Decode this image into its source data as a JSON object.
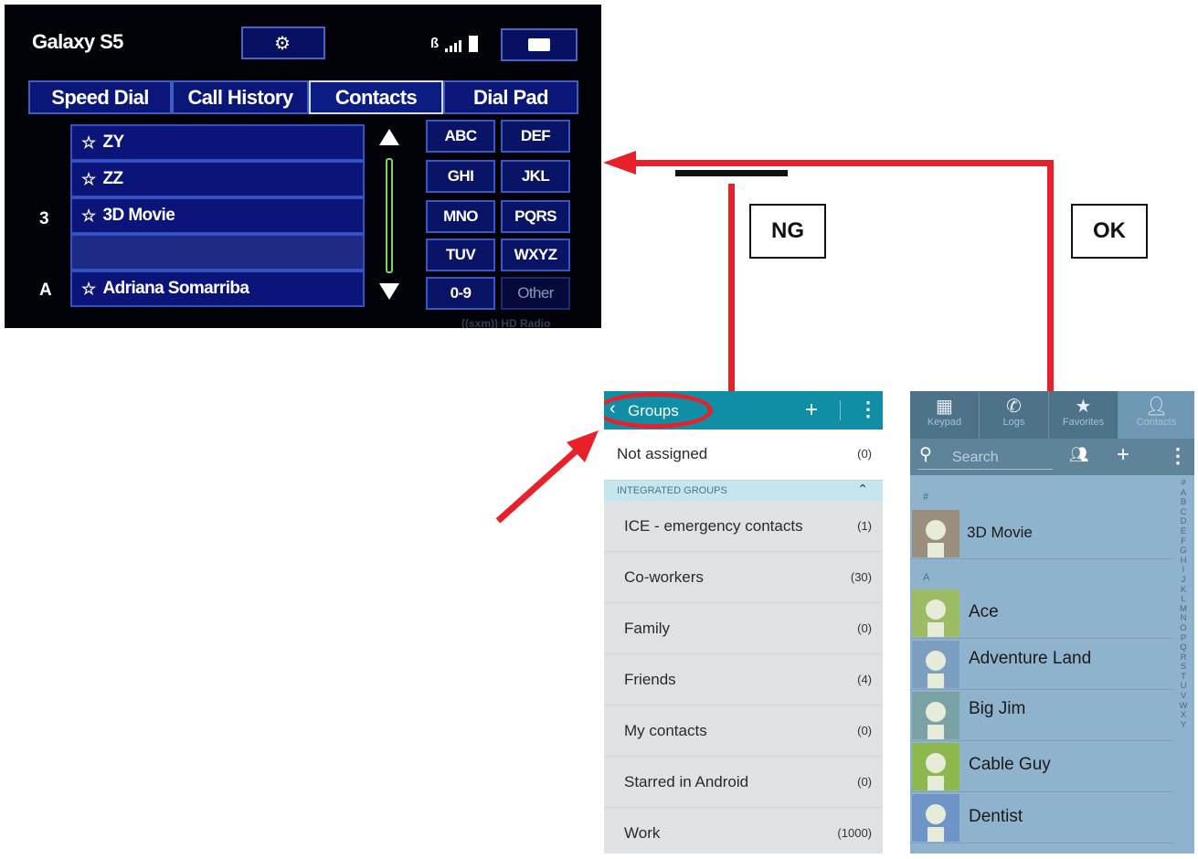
{
  "head_unit": {
    "phone_name": "Galaxy S5",
    "tabs": [
      "Speed Dial",
      "Call History",
      "Contacts",
      "Dial Pad"
    ],
    "active_tab": "Contacts",
    "index_markers": [
      "3",
      "A"
    ],
    "rows": [
      "ZY",
      "ZZ",
      "3D Movie",
      "",
      "Adriana Somarriba"
    ],
    "keys": [
      "ABC",
      "DEF",
      "GHI",
      "JKL",
      "MNO",
      "PQRS",
      "TUV",
      "WXYZ",
      "0-9",
      "Other"
    ],
    "watermark": "((sxm)) HD Radio"
  },
  "annotations": {
    "ng_label": "NG",
    "ok_label": "OK",
    "line_color": "#e8202a"
  },
  "groups_screen": {
    "title": "Groups",
    "add_icon": "plus-icon",
    "menu_icon": "overflow-menu-icon",
    "not_assigned": {
      "name": "Not assigned",
      "count": "(0)"
    },
    "section_header": "INTEGRATED GROUPS",
    "groups": [
      {
        "name": "ICE - emergency contacts",
        "count": "(1)"
      },
      {
        "name": "Co-workers",
        "count": "(30)"
      },
      {
        "name": "Family",
        "count": "(0)"
      },
      {
        "name": "Friends",
        "count": "(4)"
      },
      {
        "name": "My contacts",
        "count": "(0)"
      },
      {
        "name": "Starred in Android",
        "count": "(0)"
      },
      {
        "name": "Work",
        "count": "(1000)"
      }
    ]
  },
  "contacts_screen": {
    "tabs": [
      "Keypad",
      "Logs",
      "Favorites",
      "Contacts"
    ],
    "active_tab": "Contacts",
    "search_placeholder": "Search",
    "sections": [
      "#",
      "A"
    ],
    "contacts": [
      "3D Movie",
      "Ace",
      "Adventure Land",
      "Big Jim",
      "Cable Guy",
      "Dentist"
    ],
    "index_letters": [
      "#",
      "A",
      "B",
      "C",
      "D",
      "E",
      "F",
      "G",
      "H",
      "I",
      "J",
      "K",
      "L",
      "M",
      "N",
      "O",
      "P",
      "Q",
      "R",
      "S",
      "T",
      "U",
      "V",
      "W",
      "X",
      "Y"
    ],
    "avatar_colors": [
      "#9a8f7c",
      "#9dbb63",
      "#7c9ec0",
      "#7aa2a5",
      "#8cb84e",
      "#6f95c8"
    ]
  }
}
